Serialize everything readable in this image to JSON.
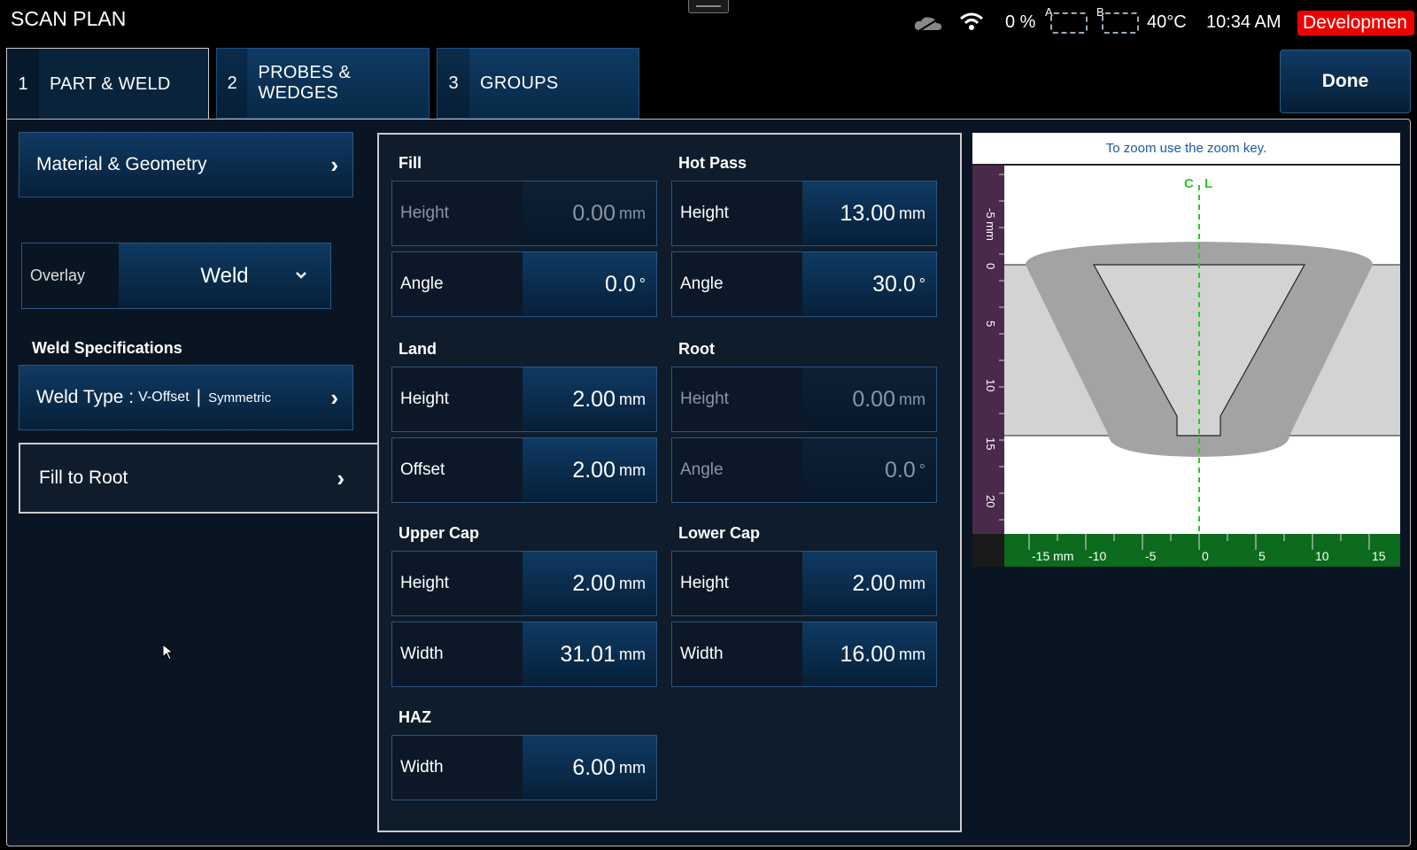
{
  "app": {
    "title": "SCAN PLAN"
  },
  "status": {
    "battery": "0 %",
    "drive_a": "A",
    "drive_b": "B",
    "temperature": "40°C",
    "time": "10:34 AM",
    "mode_badge": "Developmen"
  },
  "tabs": [
    {
      "num": "1",
      "label": "PART & WELD"
    },
    {
      "num": "2",
      "label": "PROBES & WEDGES"
    },
    {
      "num": "3",
      "label": "GROUPS"
    }
  ],
  "done_label": "Done",
  "left": {
    "material_geometry": "Material & Geometry",
    "overlay_label": "Overlay",
    "overlay_value": "Weld",
    "weld_specs_title": "Weld Specifications",
    "weld_type_prefix": "Weld Type :",
    "weld_type": "V-Offset",
    "weld_symmetry": "Symmetric",
    "fill_to_root": "Fill to Root"
  },
  "specs": {
    "fill": {
      "title": "Fill",
      "height_label": "Height",
      "height": "0.00",
      "height_unit": "mm",
      "angle_label": "Angle",
      "angle": "0.0",
      "angle_unit": "°"
    },
    "hot_pass": {
      "title": "Hot Pass",
      "height_label": "Height",
      "height": "13.00",
      "height_unit": "mm",
      "angle_label": "Angle",
      "angle": "30.0",
      "angle_unit": "°"
    },
    "land": {
      "title": "Land",
      "height_label": "Height",
      "height": "2.00",
      "height_unit": "mm",
      "offset_label": "Offset",
      "offset": "2.00",
      "offset_unit": "mm"
    },
    "root": {
      "title": "Root",
      "height_label": "Height",
      "height": "0.00",
      "height_unit": "mm",
      "angle_label": "Angle",
      "angle": "0.0",
      "angle_unit": "°"
    },
    "upper_cap": {
      "title": "Upper Cap",
      "height_label": "Height",
      "height": "2.00",
      "height_unit": "mm",
      "width_label": "Width",
      "width": "31.01",
      "width_unit": "mm"
    },
    "lower_cap": {
      "title": "Lower Cap",
      "height_label": "Height",
      "height": "2.00",
      "height_unit": "mm",
      "width_label": "Width",
      "width": "16.00",
      "width_unit": "mm"
    },
    "haz": {
      "title": "HAZ",
      "width_label": "Width",
      "width": "6.00",
      "width_unit": "mm"
    }
  },
  "preview": {
    "zoom_hint": "To zoom use the zoom key.",
    "centerline_label_c": "C",
    "centerline_label_l": "L",
    "v_ruler_labels": [
      "-5 mm",
      "0",
      "5",
      "10",
      "15",
      "20"
    ],
    "h_ruler_labels": [
      "-15 mm",
      "-10",
      "-5",
      "0",
      "5",
      "10",
      "15"
    ]
  },
  "colors": {
    "accent": "#0f3a63",
    "badge": "#e00000",
    "centerline": "#22cc22",
    "ruler_v": "#4a2a4a",
    "ruler_h": "#0d6b1e"
  }
}
